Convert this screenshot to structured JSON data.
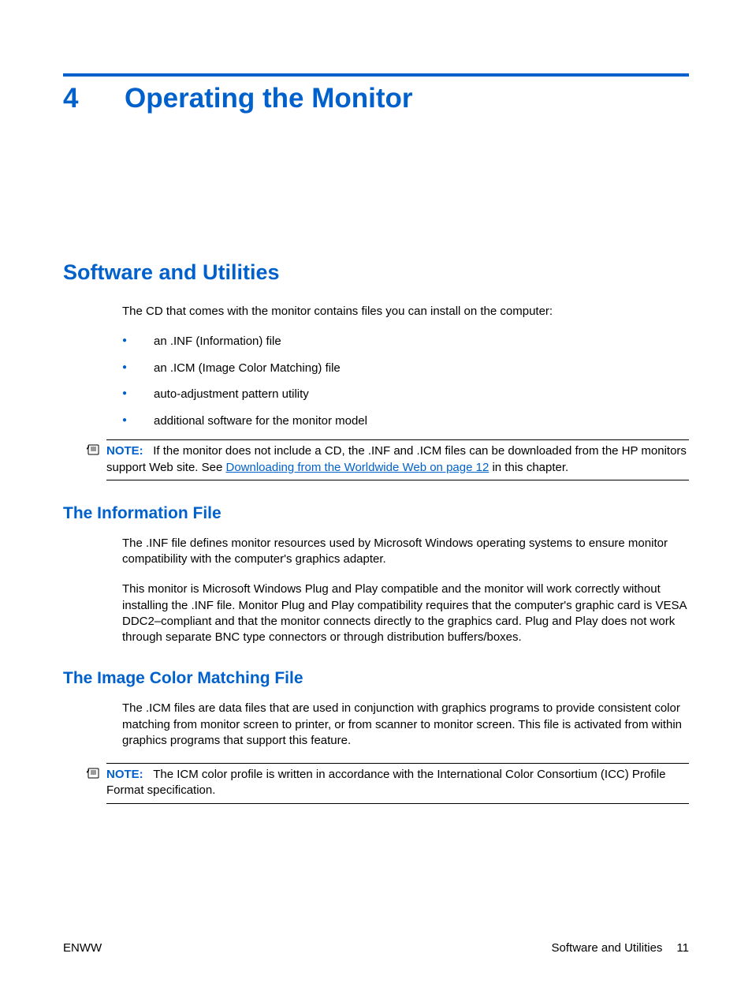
{
  "chapter": {
    "number": "4",
    "title": "Operating the Monitor"
  },
  "section": {
    "title": "Software and Utilities",
    "intro": "The CD that comes with the monitor contains files you can install on the computer:",
    "bullets": [
      "an .INF (Information) file",
      "an .ICM (Image Color Matching) file",
      "auto-adjustment pattern utility",
      "additional software for the monitor model"
    ]
  },
  "note1": {
    "label": "NOTE:",
    "text_before": "If the monitor does not include a CD, the .INF and .ICM files can be downloaded from the HP monitors support Web site. See ",
    "link": "Downloading from the Worldwide Web on page 12",
    "text_after": " in this chapter."
  },
  "info_file": {
    "heading": "The Information File",
    "p1": "The .INF file defines monitor resources used by Microsoft Windows operating systems to ensure monitor compatibility with the computer's graphics adapter.",
    "p2": "This monitor is Microsoft Windows Plug and Play compatible and the monitor will work correctly without installing the .INF file. Monitor Plug and Play compatibility requires that the computer's graphic card is VESA DDC2–compliant and that the monitor connects directly to the graphics card. Plug and Play does not work through separate BNC type connectors or through distribution buffers/boxes."
  },
  "icm_file": {
    "heading": "The Image Color Matching File",
    "p1": "The .ICM files are data files that are used in conjunction with graphics programs to provide consistent color matching from monitor screen to printer, or from scanner to monitor screen. This file is activated from within graphics programs that support this feature."
  },
  "note2": {
    "label": "NOTE:",
    "text": "The ICM color profile is written in accordance with the International Color Consortium (ICC) Profile Format specification."
  },
  "footer": {
    "left": "ENWW",
    "right_label": "Software and Utilities",
    "page": "11"
  }
}
